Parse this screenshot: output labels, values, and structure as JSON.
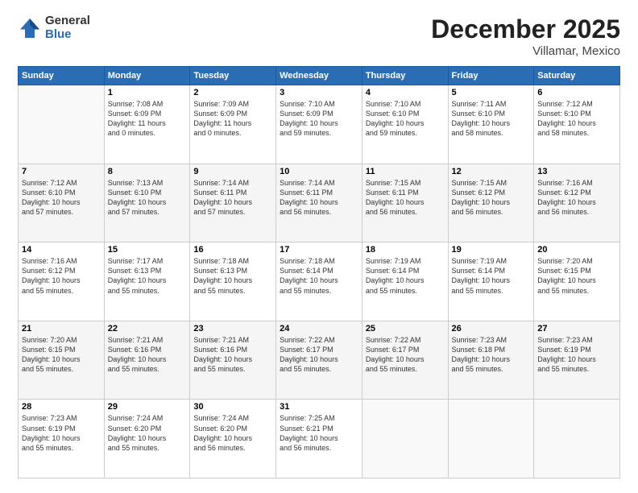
{
  "logo": {
    "general": "General",
    "blue": "Blue"
  },
  "title": "December 2025",
  "subtitle": "Villamar, Mexico",
  "days": [
    "Sunday",
    "Monday",
    "Tuesday",
    "Wednesday",
    "Thursday",
    "Friday",
    "Saturday"
  ],
  "weeks": [
    [
      {
        "day": "",
        "info": ""
      },
      {
        "day": "1",
        "info": "Sunrise: 7:08 AM\nSunset: 6:09 PM\nDaylight: 11 hours\nand 0 minutes."
      },
      {
        "day": "2",
        "info": "Sunrise: 7:09 AM\nSunset: 6:09 PM\nDaylight: 11 hours\nand 0 minutes."
      },
      {
        "day": "3",
        "info": "Sunrise: 7:10 AM\nSunset: 6:09 PM\nDaylight: 10 hours\nand 59 minutes."
      },
      {
        "day": "4",
        "info": "Sunrise: 7:10 AM\nSunset: 6:10 PM\nDaylight: 10 hours\nand 59 minutes."
      },
      {
        "day": "5",
        "info": "Sunrise: 7:11 AM\nSunset: 6:10 PM\nDaylight: 10 hours\nand 58 minutes."
      },
      {
        "day": "6",
        "info": "Sunrise: 7:12 AM\nSunset: 6:10 PM\nDaylight: 10 hours\nand 58 minutes."
      }
    ],
    [
      {
        "day": "7",
        "info": "Sunrise: 7:12 AM\nSunset: 6:10 PM\nDaylight: 10 hours\nand 57 minutes."
      },
      {
        "day": "8",
        "info": "Sunrise: 7:13 AM\nSunset: 6:10 PM\nDaylight: 10 hours\nand 57 minutes."
      },
      {
        "day": "9",
        "info": "Sunrise: 7:14 AM\nSunset: 6:11 PM\nDaylight: 10 hours\nand 57 minutes."
      },
      {
        "day": "10",
        "info": "Sunrise: 7:14 AM\nSunset: 6:11 PM\nDaylight: 10 hours\nand 56 minutes."
      },
      {
        "day": "11",
        "info": "Sunrise: 7:15 AM\nSunset: 6:11 PM\nDaylight: 10 hours\nand 56 minutes."
      },
      {
        "day": "12",
        "info": "Sunrise: 7:15 AM\nSunset: 6:12 PM\nDaylight: 10 hours\nand 56 minutes."
      },
      {
        "day": "13",
        "info": "Sunrise: 7:16 AM\nSunset: 6:12 PM\nDaylight: 10 hours\nand 56 minutes."
      }
    ],
    [
      {
        "day": "14",
        "info": "Sunrise: 7:16 AM\nSunset: 6:12 PM\nDaylight: 10 hours\nand 55 minutes."
      },
      {
        "day": "15",
        "info": "Sunrise: 7:17 AM\nSunset: 6:13 PM\nDaylight: 10 hours\nand 55 minutes."
      },
      {
        "day": "16",
        "info": "Sunrise: 7:18 AM\nSunset: 6:13 PM\nDaylight: 10 hours\nand 55 minutes."
      },
      {
        "day": "17",
        "info": "Sunrise: 7:18 AM\nSunset: 6:14 PM\nDaylight: 10 hours\nand 55 minutes."
      },
      {
        "day": "18",
        "info": "Sunrise: 7:19 AM\nSunset: 6:14 PM\nDaylight: 10 hours\nand 55 minutes."
      },
      {
        "day": "19",
        "info": "Sunrise: 7:19 AM\nSunset: 6:14 PM\nDaylight: 10 hours\nand 55 minutes."
      },
      {
        "day": "20",
        "info": "Sunrise: 7:20 AM\nSunset: 6:15 PM\nDaylight: 10 hours\nand 55 minutes."
      }
    ],
    [
      {
        "day": "21",
        "info": "Sunrise: 7:20 AM\nSunset: 6:15 PM\nDaylight: 10 hours\nand 55 minutes."
      },
      {
        "day": "22",
        "info": "Sunrise: 7:21 AM\nSunset: 6:16 PM\nDaylight: 10 hours\nand 55 minutes."
      },
      {
        "day": "23",
        "info": "Sunrise: 7:21 AM\nSunset: 6:16 PM\nDaylight: 10 hours\nand 55 minutes."
      },
      {
        "day": "24",
        "info": "Sunrise: 7:22 AM\nSunset: 6:17 PM\nDaylight: 10 hours\nand 55 minutes."
      },
      {
        "day": "25",
        "info": "Sunrise: 7:22 AM\nSunset: 6:17 PM\nDaylight: 10 hours\nand 55 minutes."
      },
      {
        "day": "26",
        "info": "Sunrise: 7:23 AM\nSunset: 6:18 PM\nDaylight: 10 hours\nand 55 minutes."
      },
      {
        "day": "27",
        "info": "Sunrise: 7:23 AM\nSunset: 6:19 PM\nDaylight: 10 hours\nand 55 minutes."
      }
    ],
    [
      {
        "day": "28",
        "info": "Sunrise: 7:23 AM\nSunset: 6:19 PM\nDaylight: 10 hours\nand 55 minutes."
      },
      {
        "day": "29",
        "info": "Sunrise: 7:24 AM\nSunset: 6:20 PM\nDaylight: 10 hours\nand 55 minutes."
      },
      {
        "day": "30",
        "info": "Sunrise: 7:24 AM\nSunset: 6:20 PM\nDaylight: 10 hours\nand 56 minutes."
      },
      {
        "day": "31",
        "info": "Sunrise: 7:25 AM\nSunset: 6:21 PM\nDaylight: 10 hours\nand 56 minutes."
      },
      {
        "day": "",
        "info": ""
      },
      {
        "day": "",
        "info": ""
      },
      {
        "day": "",
        "info": ""
      }
    ]
  ]
}
